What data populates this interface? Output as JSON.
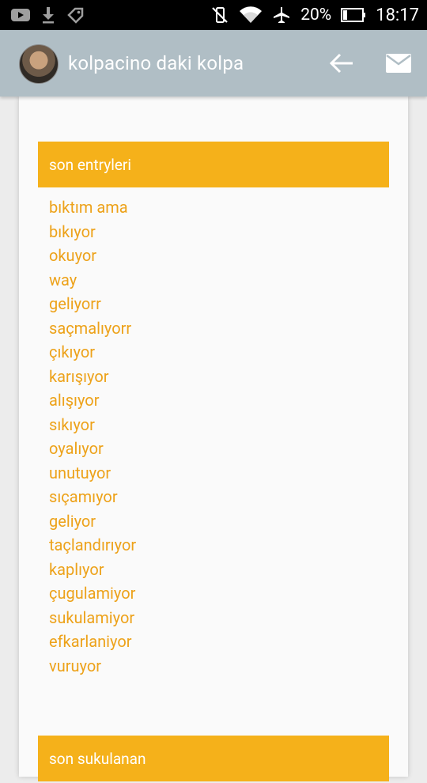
{
  "status_bar": {
    "battery": "20%",
    "time": "18:17"
  },
  "app_bar": {
    "title": "kolpacino daki kolpa"
  },
  "sections": [
    {
      "title": "son entryleri",
      "entries": [
        "bıktım ama",
        "bıkıyor",
        "okuyor",
        "way",
        "geliyorr",
        "saçmalıyorr",
        "çıkıyor",
        "karışıyor",
        "alışıyor",
        "sıkıyor",
        "oyalıyor",
        "unutuyor",
        "sıçamıyor",
        "geliyor",
        "taçlandırıyor",
        "kaplıyor",
        "çugulamiyor",
        "sukulamiyor",
        "efkarlaniyor",
        "vuruyor"
      ]
    },
    {
      "title": "son sukulanan"
    }
  ],
  "colors": {
    "accent": "#f5b11a",
    "link": "#eda21a",
    "app_bar": "#b0bec5"
  }
}
